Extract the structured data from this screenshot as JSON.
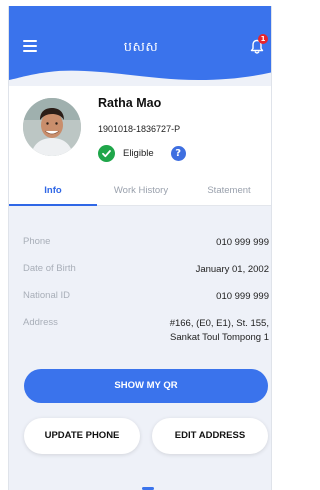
{
  "header": {
    "title": "បសស",
    "notification_count": "1",
    "colors": {
      "primary": "#3a73ec",
      "badge": "#e7252c"
    },
    "icons": {
      "menu": "hamburger-icon",
      "notifications": "bell-icon"
    }
  },
  "profile": {
    "name": "Ratha Mao",
    "id_number": "1901018-1836727-P",
    "status": "Eligible",
    "status_color": "#1fa64a",
    "help_symbol": "?"
  },
  "tabs": [
    {
      "label": "Info",
      "active": true
    },
    {
      "label": "Work History",
      "active": false
    },
    {
      "label": "Statement",
      "active": false
    }
  ],
  "info_rows": [
    {
      "label": "Phone",
      "value": "010 999 999"
    },
    {
      "label": "Date of Birth",
      "value": "January 01, 2002"
    },
    {
      "label": "National ID",
      "value": "010 999 999"
    },
    {
      "label": "Address",
      "value_line1": "#166, (E0, E1), St. 155,",
      "value_line2": "Sankat Toul Tompong 1"
    }
  ],
  "buttons": {
    "show_qr": "SHOW MY QR",
    "update_phone": "UPDATE PHONE",
    "edit_address": "EDIT ADDRESS"
  }
}
